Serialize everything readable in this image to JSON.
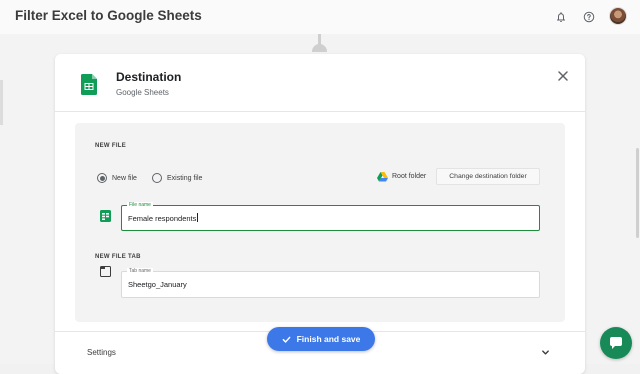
{
  "app": {
    "title": "Filter Excel to Google Sheets"
  },
  "topbar": {
    "icons": [
      "bell-icon",
      "help-icon"
    ]
  },
  "destination": {
    "title": "Destination",
    "subtitle": "Google Sheets",
    "icon": "google-sheets-icon",
    "accent_color": "#0f9d58"
  },
  "new_file": {
    "section_label": "NEW FILE",
    "radio_new_label": "New file",
    "radio_existing_label": "Existing file",
    "selected": "New file",
    "folder_label": "Root folder",
    "change_button_label": "Change destination folder",
    "file_name_legend": "File name",
    "file_name_value": "Female respondents",
    "field_border_color": "#1e8e3e"
  },
  "new_file_tab": {
    "section_label": "NEW FILE TAB",
    "tab_name_legend": "Tab name",
    "tab_name_value": "Sheetgo_January"
  },
  "settings": {
    "label": "Settings"
  },
  "finish": {
    "label": "Finish and save",
    "color": "#3c78e8"
  },
  "chat": {
    "color": "#188a57"
  }
}
